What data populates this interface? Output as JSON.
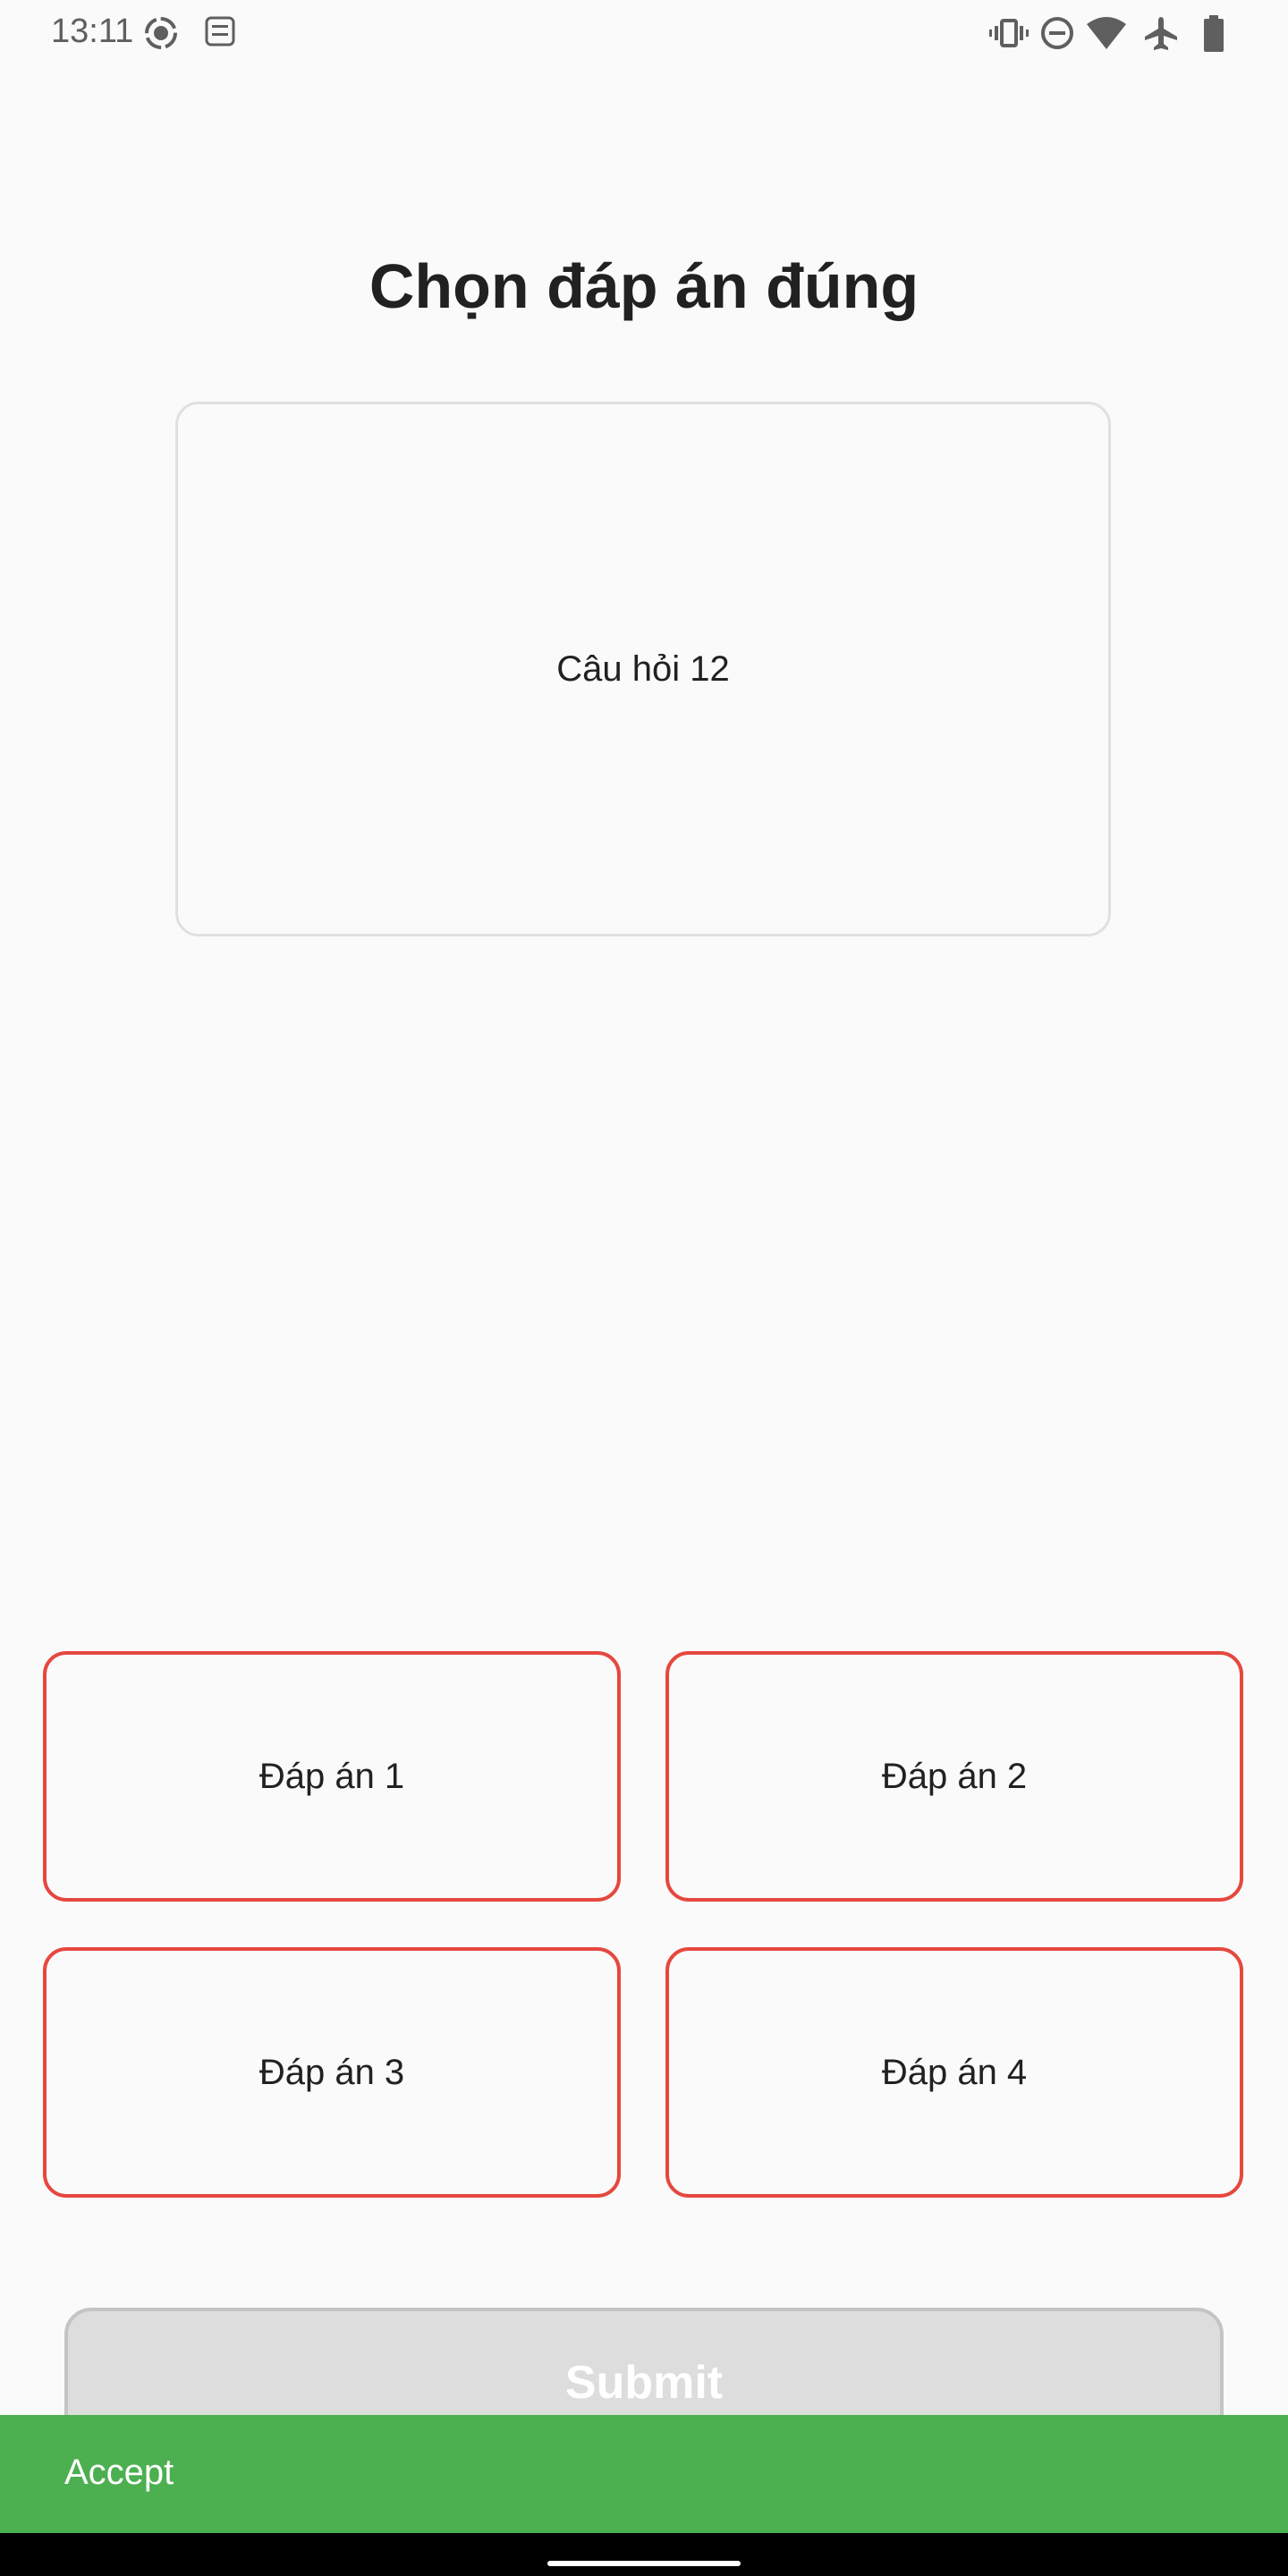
{
  "status_bar": {
    "time": "13:11",
    "icons": [
      "screen-record-icon",
      "keyboard-lang-icon",
      "vibrate-icon",
      "do-not-disturb-icon",
      "wifi-icon",
      "airplane-icon",
      "battery-icon"
    ]
  },
  "quiz": {
    "title": "Chọn đáp án đúng",
    "question": "Câu hỏi 12",
    "answers": [
      "Đáp án 1",
      "Đáp án 2",
      "Đáp án 3",
      "Đáp án 4"
    ],
    "submit_label": "Submit"
  },
  "snackbar": {
    "action_label": "Accept"
  },
  "colors": {
    "background": "#fafafa",
    "answer_border": "#e5483f",
    "submit_disabled": "#dddddd",
    "accept_bar": "#4caf50"
  }
}
